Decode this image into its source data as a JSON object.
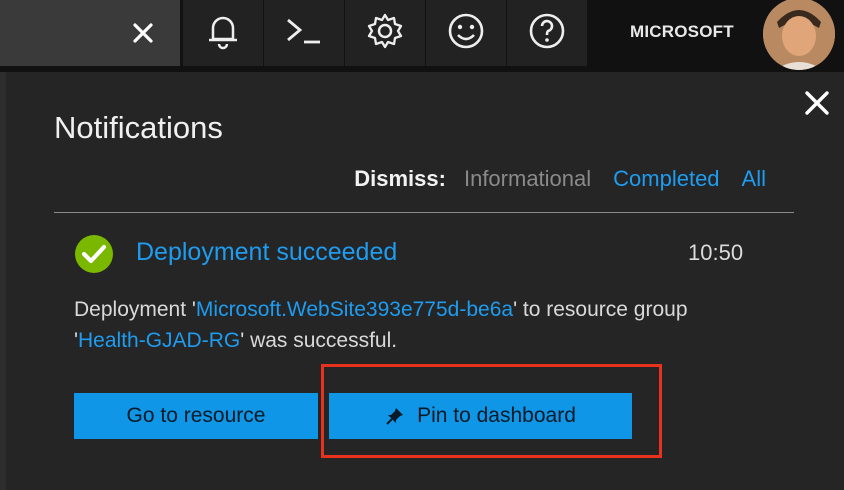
{
  "topbar": {
    "account_label": "MICROSOFT",
    "icons": [
      "close-icon",
      "bell-icon",
      "cloud-shell-icon",
      "gear-icon",
      "smiley-icon",
      "help-icon"
    ]
  },
  "notifications": {
    "title": "Notifications",
    "dismiss": {
      "label": "Dismiss:",
      "informational": "Informational",
      "completed": "Completed",
      "all": "All"
    },
    "item": {
      "title": "Deployment succeeded",
      "time": "10:50",
      "body_prefix": "Deployment '",
      "deployment_name": "Microsoft.WebSite393e775d-be6a",
      "body_middle": "' to resource group '",
      "resource_group": "Health-GJAD-RG",
      "body_suffix": "' was successful.",
      "status_color": "#7ab800"
    },
    "buttons": {
      "go_to_resource": "Go to resource",
      "pin_to_dashboard": "Pin to dashboard"
    }
  },
  "colors": {
    "accent": "#1e9cf0",
    "button": "#0f96e6",
    "highlight": "#e8321e"
  }
}
